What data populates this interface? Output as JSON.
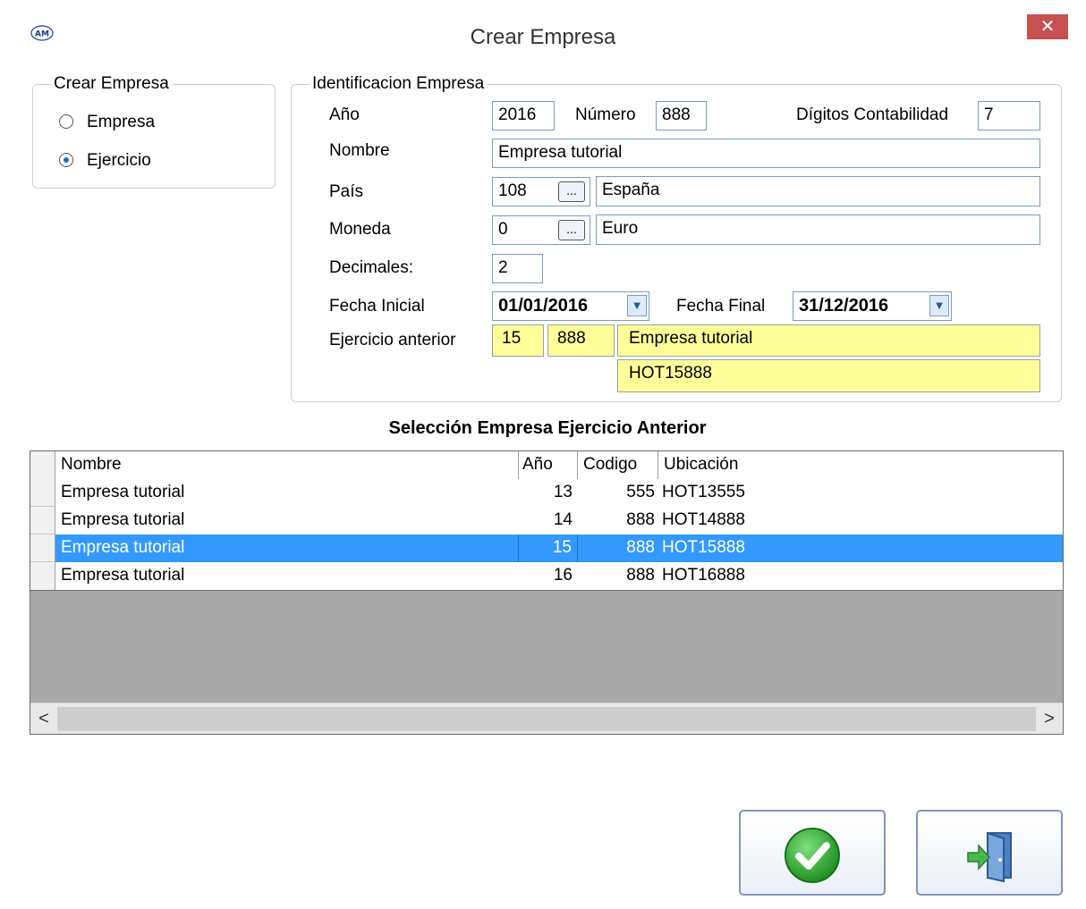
{
  "window": {
    "title": "Crear Empresa",
    "app_icon": "AM",
    "close_symbol": "✕"
  },
  "crear_group": {
    "legend": "Crear Empresa",
    "options": [
      "Empresa",
      "Ejercicio"
    ],
    "selected": "Ejercicio"
  },
  "ident": {
    "legend": "Identificacion Empresa",
    "ano_label": "Año",
    "ano_value": "2016",
    "numero_label": "Número",
    "numero_value": "888",
    "digitos_label": "Dígitos Contabilidad",
    "digitos_value": "7",
    "nombre_label": "Nombre",
    "nombre_value": "Empresa tutorial",
    "pais_label": "País",
    "pais_code": "108",
    "pais_name": "España",
    "moneda_label": "Moneda",
    "moneda_code": "0",
    "moneda_name": "Euro",
    "decimales_label": "Decimales:",
    "decimales_value": "2",
    "fecha_inicial_label": "Fecha Inicial",
    "fecha_inicial_value": "01/01/2016",
    "fecha_final_label": "Fecha Final",
    "fecha_final_value": "31/12/2016",
    "ejercicio_label": "Ejercicio anterior",
    "ej_ano": "15",
    "ej_num": "888",
    "ej_nombre": "Empresa tutorial",
    "ej_ubicacion": "HOT15888",
    "ellipsis": "..."
  },
  "grid": {
    "title": "Selección Empresa Ejercicio Anterior",
    "columns": [
      "Nombre",
      "Año",
      "Codigo",
      "Ubicación"
    ],
    "rows": [
      {
        "nombre": "Empresa tutorial",
        "ano": "13",
        "codigo": "555",
        "ubicacion": "HOT13555"
      },
      {
        "nombre": "Empresa tutorial",
        "ano": "14",
        "codigo": "888",
        "ubicacion": "HOT14888"
      },
      {
        "nombre": "Empresa tutorial",
        "ano": "15",
        "codigo": "888",
        "ubicacion": "HOT15888"
      },
      {
        "nombre": "Empresa tutorial",
        "ano": "16",
        "codigo": "888",
        "ubicacion": "HOT16888"
      }
    ],
    "selected_row": 2,
    "scroll_left": "<",
    "scroll_right": ">"
  },
  "buttons": {
    "accept_icon": "check-icon",
    "exit_icon": "exit-door-icon"
  },
  "colors": {
    "selection": "#3399ff",
    "yellow_field": "#ffff99",
    "close_button": "#c75050"
  }
}
